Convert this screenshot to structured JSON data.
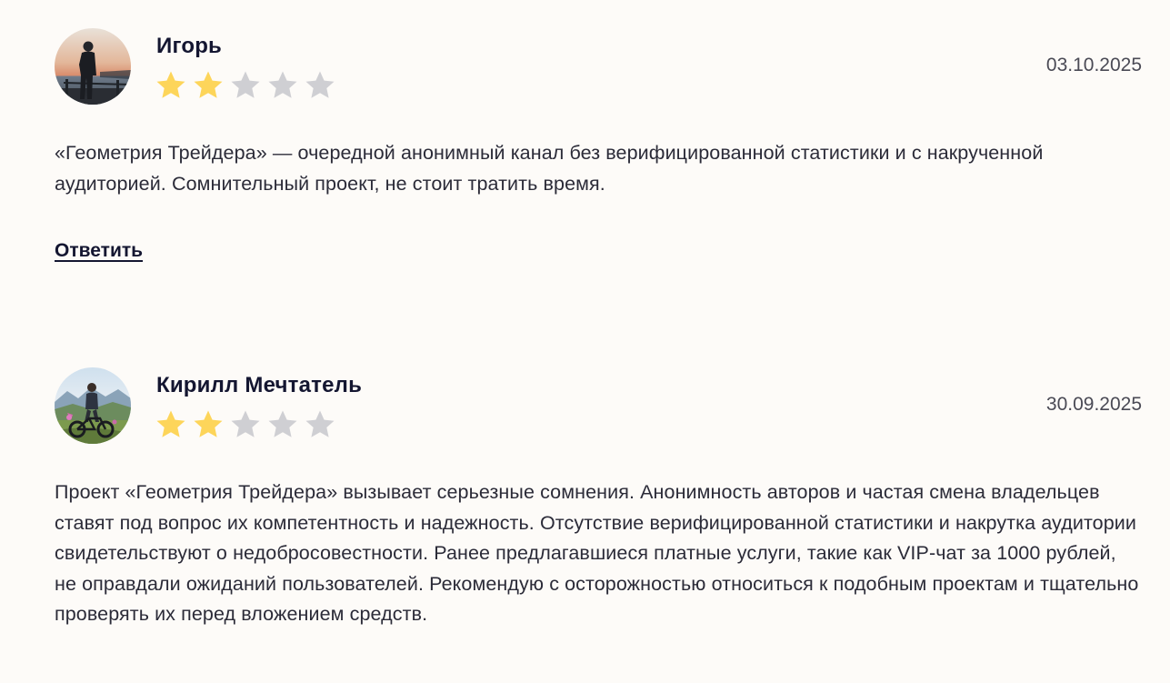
{
  "colors": {
    "star_filled": "#fdd55a",
    "star_empty": "#cfcfd3",
    "name": "#141631",
    "text": "#2b2b38",
    "background": "#fdfbf8"
  },
  "reviews": [
    {
      "author": "Игорь",
      "rating": 2,
      "max_rating": 5,
      "date": "03.10.2025",
      "text": "«Геометрия Трейдера» — очередной анонимный канал без верифицированной статистики и с накрученной аудиторией. Сомнительный проект, не стоит тратить время.",
      "reply_label": "Ответить",
      "avatar_icon": "sunset-pier-photo"
    },
    {
      "author": "Кирилл Мечтатель",
      "rating": 2,
      "max_rating": 5,
      "date": "30.09.2025",
      "text": "Проект «Геометрия Трейдера» вызывает серьезные сомнения. Анонимность авторов и частая смена владельцев ставят под вопрос их компетентность и надежность. Отсутствие верифицированной статистики и накрутка аудитории свидетельствуют о недобросовестности. Ранее предлагавшиеся платные услуги, такие как VIP-чат за 1000 рублей, не оправдали ожиданий пользователей. Рекомендую с осторожностью относиться к подобным проектам и тщательно проверять их перед вложением средств.",
      "avatar_icon": "mountain-bike-photo"
    }
  ]
}
